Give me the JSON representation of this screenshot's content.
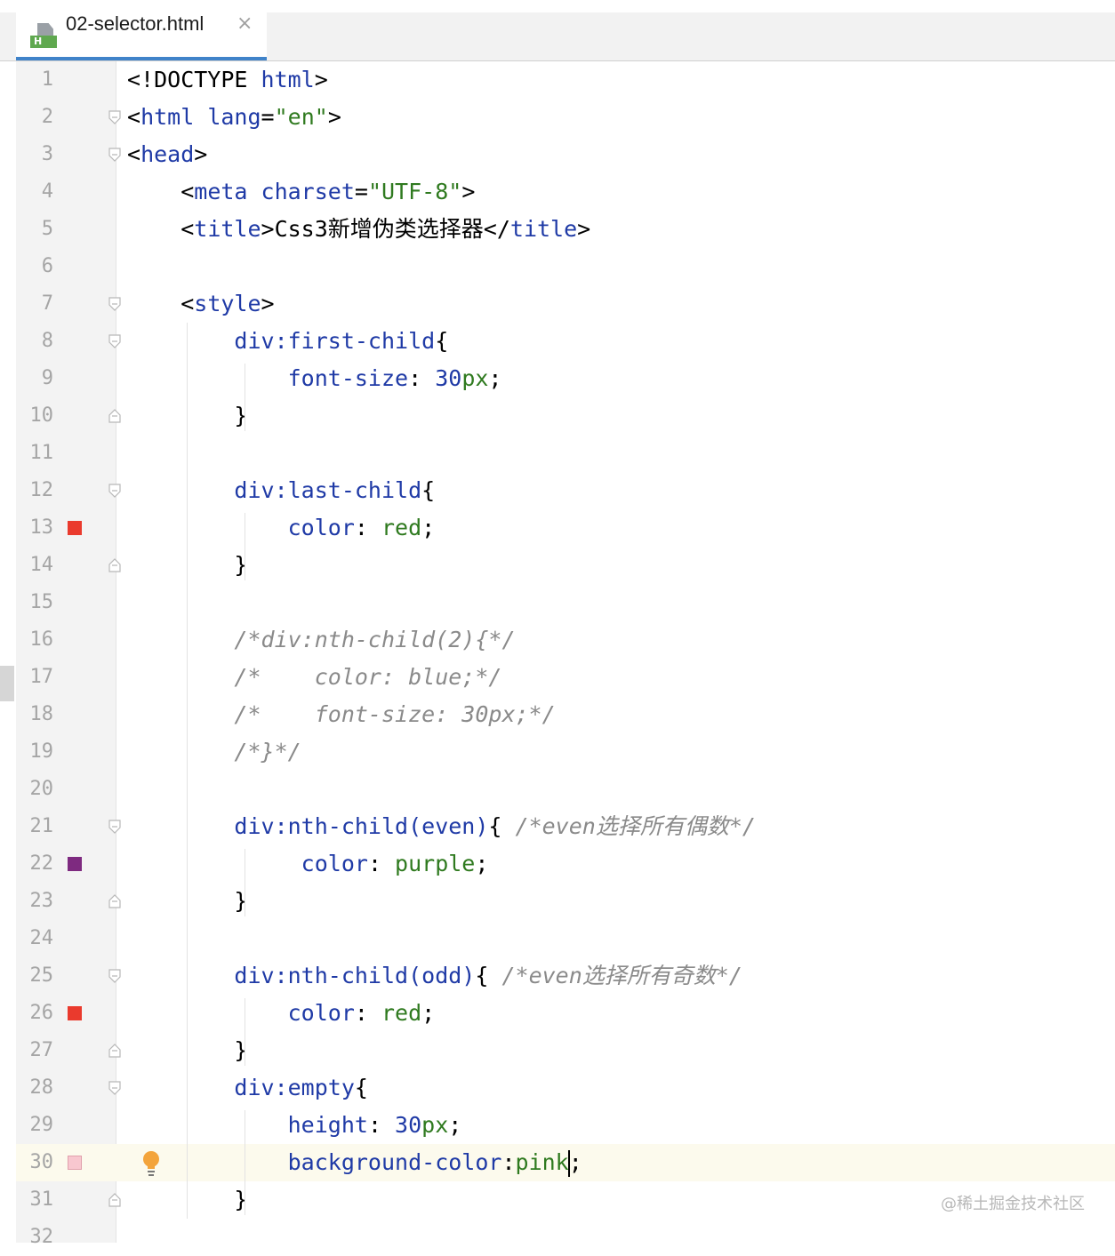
{
  "tab": {
    "title": "02-selector.html",
    "close_glyph": "×",
    "icon_letter": "H"
  },
  "watermark": "@稀土掘金技术社区",
  "lines": [
    {
      "n": "1",
      "fold": "",
      "swatch": "",
      "seg": [
        [
          "punc",
          "<!DOCTYPE "
        ],
        [
          "tag",
          "html"
        ],
        [
          "punc",
          ">"
        ]
      ]
    },
    {
      "n": "2",
      "fold": "open",
      "swatch": "",
      "seg": [
        [
          "punc",
          "<"
        ],
        [
          "tag",
          "html "
        ],
        [
          "attr",
          "lang"
        ],
        [
          "punc",
          "="
        ],
        [
          "str",
          "\"en\""
        ],
        [
          "punc",
          ">"
        ]
      ]
    },
    {
      "n": "3",
      "fold": "open",
      "swatch": "",
      "seg": [
        [
          "punc",
          "<"
        ],
        [
          "tag",
          "head"
        ],
        [
          "punc",
          ">"
        ]
      ]
    },
    {
      "n": "4",
      "fold": "",
      "swatch": "",
      "seg": [
        [
          "punc",
          "    <"
        ],
        [
          "tag",
          "meta "
        ],
        [
          "attr",
          "charset"
        ],
        [
          "punc",
          "="
        ],
        [
          "str",
          "\"UTF-8\""
        ],
        [
          "punc",
          ">"
        ]
      ]
    },
    {
      "n": "5",
      "fold": "",
      "swatch": "",
      "seg": [
        [
          "punc",
          "    <"
        ],
        [
          "tag",
          "title"
        ],
        [
          "punc",
          ">Css3新增伪类选择器</"
        ],
        [
          "tag",
          "title"
        ],
        [
          "punc",
          ">"
        ]
      ]
    },
    {
      "n": "6",
      "fold": "",
      "swatch": "",
      "seg": []
    },
    {
      "n": "7",
      "fold": "open",
      "swatch": "",
      "seg": [
        [
          "punc",
          "    <"
        ],
        [
          "tag",
          "style"
        ],
        [
          "punc",
          ">"
        ]
      ]
    },
    {
      "n": "8",
      "fold": "open",
      "swatch": "",
      "seg": [
        [
          "punc",
          "        "
        ],
        [
          "sel",
          "div:first-child"
        ],
        [
          "punc",
          "{"
        ]
      ]
    },
    {
      "n": "9",
      "fold": "",
      "swatch": "",
      "seg": [
        [
          "punc",
          "            "
        ],
        [
          "prop",
          "font-size"
        ],
        [
          "punc",
          ": "
        ],
        [
          "num",
          "30"
        ],
        [
          "val",
          "px"
        ],
        [
          "punc",
          ";"
        ]
      ]
    },
    {
      "n": "10",
      "fold": "end",
      "swatch": "",
      "seg": [
        [
          "punc",
          "        }"
        ]
      ]
    },
    {
      "n": "11",
      "fold": "",
      "swatch": "",
      "seg": []
    },
    {
      "n": "12",
      "fold": "open",
      "swatch": "",
      "seg": [
        [
          "punc",
          "        "
        ],
        [
          "sel",
          "div:last-child"
        ],
        [
          "punc",
          "{"
        ]
      ]
    },
    {
      "n": "13",
      "fold": "",
      "swatch": "red",
      "seg": [
        [
          "punc",
          "            "
        ],
        [
          "prop",
          "color"
        ],
        [
          "punc",
          ": "
        ],
        [
          "val",
          "red"
        ],
        [
          "punc",
          ";"
        ]
      ]
    },
    {
      "n": "14",
      "fold": "end",
      "swatch": "",
      "seg": [
        [
          "punc",
          "        }"
        ]
      ]
    },
    {
      "n": "15",
      "fold": "",
      "swatch": "",
      "seg": []
    },
    {
      "n": "16",
      "fold": "",
      "swatch": "",
      "seg": [
        [
          "punc",
          "        "
        ],
        [
          "cmt",
          "/*div:nth-child(2){*/"
        ]
      ]
    },
    {
      "n": "17",
      "fold": "",
      "swatch": "",
      "seg": [
        [
          "punc",
          "        "
        ],
        [
          "cmt",
          "/*    color: blue;*/"
        ]
      ]
    },
    {
      "n": "18",
      "fold": "",
      "swatch": "",
      "seg": [
        [
          "punc",
          "        "
        ],
        [
          "cmt",
          "/*    font-size: 30px;*/"
        ]
      ]
    },
    {
      "n": "19",
      "fold": "",
      "swatch": "",
      "seg": [
        [
          "punc",
          "        "
        ],
        [
          "cmt",
          "/*}*/"
        ]
      ]
    },
    {
      "n": "20",
      "fold": "",
      "swatch": "",
      "seg": []
    },
    {
      "n": "21",
      "fold": "open",
      "swatch": "",
      "seg": [
        [
          "punc",
          "        "
        ],
        [
          "sel",
          "div:nth-child(even)"
        ],
        [
          "punc",
          "{ "
        ],
        [
          "cmt",
          "/*even选择所有偶数*/"
        ]
      ]
    },
    {
      "n": "22",
      "fold": "",
      "swatch": "purple",
      "seg": [
        [
          "punc",
          "             "
        ],
        [
          "prop",
          "color"
        ],
        [
          "punc",
          ": "
        ],
        [
          "val",
          "purple"
        ],
        [
          "punc",
          ";"
        ]
      ]
    },
    {
      "n": "23",
      "fold": "end",
      "swatch": "",
      "seg": [
        [
          "punc",
          "        }"
        ]
      ]
    },
    {
      "n": "24",
      "fold": "",
      "swatch": "",
      "seg": []
    },
    {
      "n": "25",
      "fold": "open",
      "swatch": "",
      "seg": [
        [
          "punc",
          "        "
        ],
        [
          "sel",
          "div:nth-child(odd)"
        ],
        [
          "punc",
          "{ "
        ],
        [
          "cmt",
          "/*even选择所有奇数*/"
        ]
      ]
    },
    {
      "n": "26",
      "fold": "",
      "swatch": "red",
      "seg": [
        [
          "punc",
          "            "
        ],
        [
          "prop",
          "color"
        ],
        [
          "punc",
          ": "
        ],
        [
          "val",
          "red"
        ],
        [
          "punc",
          ";"
        ]
      ]
    },
    {
      "n": "27",
      "fold": "end",
      "swatch": "",
      "seg": [
        [
          "punc",
          "        }"
        ]
      ]
    },
    {
      "n": "28",
      "fold": "open",
      "swatch": "",
      "seg": [
        [
          "punc",
          "        "
        ],
        [
          "sel",
          "div:empty"
        ],
        [
          "punc",
          "{"
        ]
      ]
    },
    {
      "n": "29",
      "fold": "",
      "swatch": "",
      "seg": [
        [
          "punc",
          "            "
        ],
        [
          "prop",
          "height"
        ],
        [
          "punc",
          ": "
        ],
        [
          "num",
          "30"
        ],
        [
          "val",
          "px"
        ],
        [
          "punc",
          ";"
        ]
      ]
    },
    {
      "n": "30",
      "fold": "",
      "swatch": "pink",
      "current": true,
      "seg": [
        [
          "punc",
          "            "
        ],
        [
          "prop",
          "background-color"
        ],
        [
          "punc",
          ":"
        ],
        [
          "val",
          "pink"
        ],
        [
          "caret",
          ""
        ],
        [
          "punc",
          ";"
        ]
      ]
    },
    {
      "n": "31",
      "fold": "end",
      "swatch": "",
      "seg": [
        [
          "punc",
          "        }"
        ]
      ]
    },
    {
      "n": "32",
      "fold": "",
      "swatch": "",
      "seg": []
    }
  ],
  "swatch_colors": {
    "red": "#ea3a2d",
    "purple": "#7e2a80",
    "pink": "#f8c7cf"
  }
}
